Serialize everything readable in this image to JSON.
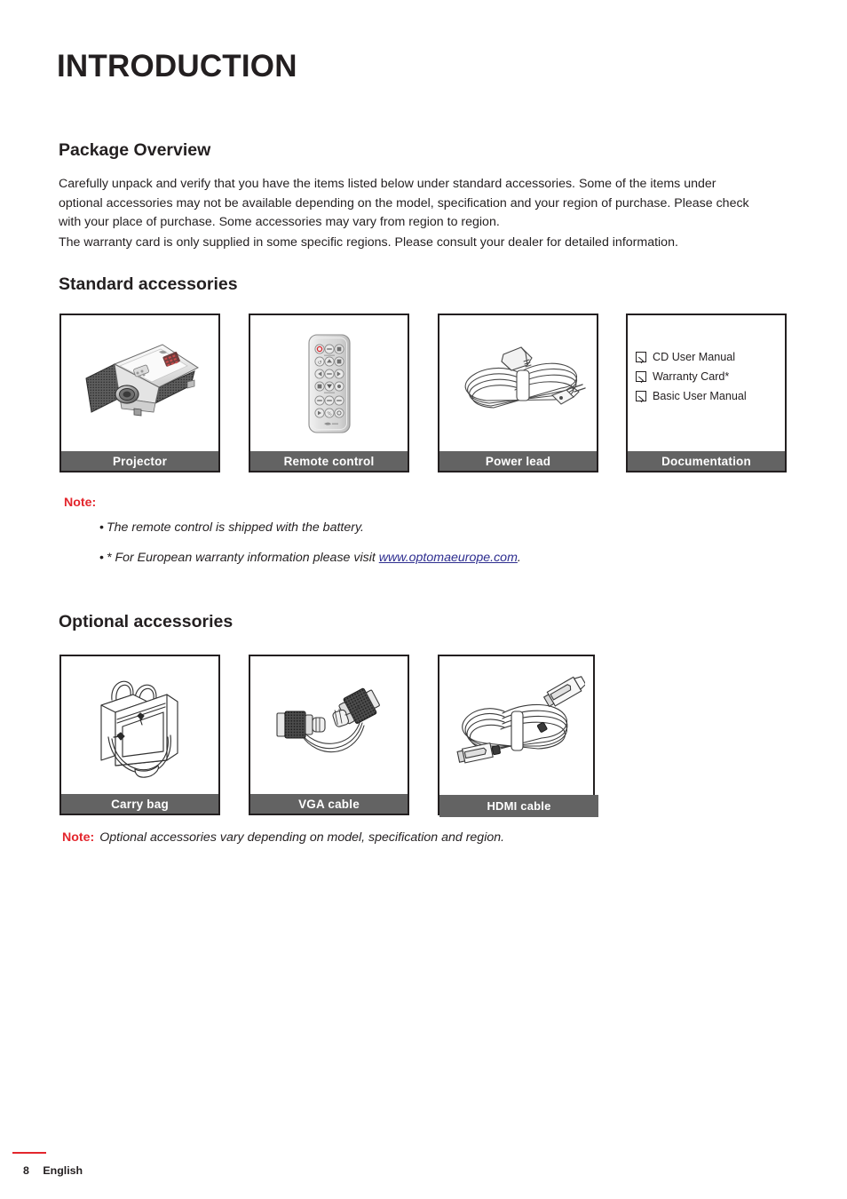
{
  "chapter": {
    "title": "INTRODUCTION"
  },
  "sections": {
    "package_overview": {
      "heading": "Package Overview",
      "paragraph_1": "Carefully unpack and verify that you have the items listed below under standard accessories. Some of the items under optional accessories may not be available depending on the model, specification and your region of purchase. Please check with your place of purchase. Some accessories may vary from region to region.",
      "paragraph_2": "The warranty card is only supplied in some specific regions. Please consult your dealer for detailed information."
    },
    "standard_accessories": {
      "heading": "Standard accessories",
      "items": [
        {
          "label": "Projector",
          "icon": "projector-illustration"
        },
        {
          "label": "Remote control",
          "icon": "remote-control-illustration"
        },
        {
          "label": "Power lead",
          "icon": "power-lead-illustration"
        },
        {
          "label": "Documentation",
          "icon": "documentation-checklist"
        }
      ],
      "documentation_checklist": [
        {
          "label": "CD User Manual",
          "checked": true
        },
        {
          "label": "Warranty Card*",
          "checked": true
        },
        {
          "label": "Basic User Manual",
          "checked": true
        }
      ],
      "note": {
        "label": "Note:",
        "bullets": [
          {
            "bullet": "•",
            "text": "The remote control is shipped with the battery."
          },
          {
            "bullet": "•",
            "text_before": "* For European warranty information please visit ",
            "link_text": "www.optomaeurope.com",
            "text_after": "."
          }
        ]
      }
    },
    "optional_accessories": {
      "heading": "Optional accessories",
      "items": [
        {
          "label": "Carry bag",
          "icon": "carry-bag-illustration"
        },
        {
          "label": "VGA cable",
          "icon": "vga-cable-illustration"
        },
        {
          "label": "HDMI cable",
          "icon": "hdmi-cable-illustration"
        }
      ],
      "note": {
        "label": "Note:",
        "text": "Optional accessories vary depending on model, specification and region."
      }
    }
  },
  "footer": {
    "page_number": "8",
    "language": "English"
  },
  "colors": {
    "text": "#231f20",
    "note_red": "#e3262d",
    "label_bar_gray": "#636363",
    "link_blue": "#2d2d8f"
  }
}
